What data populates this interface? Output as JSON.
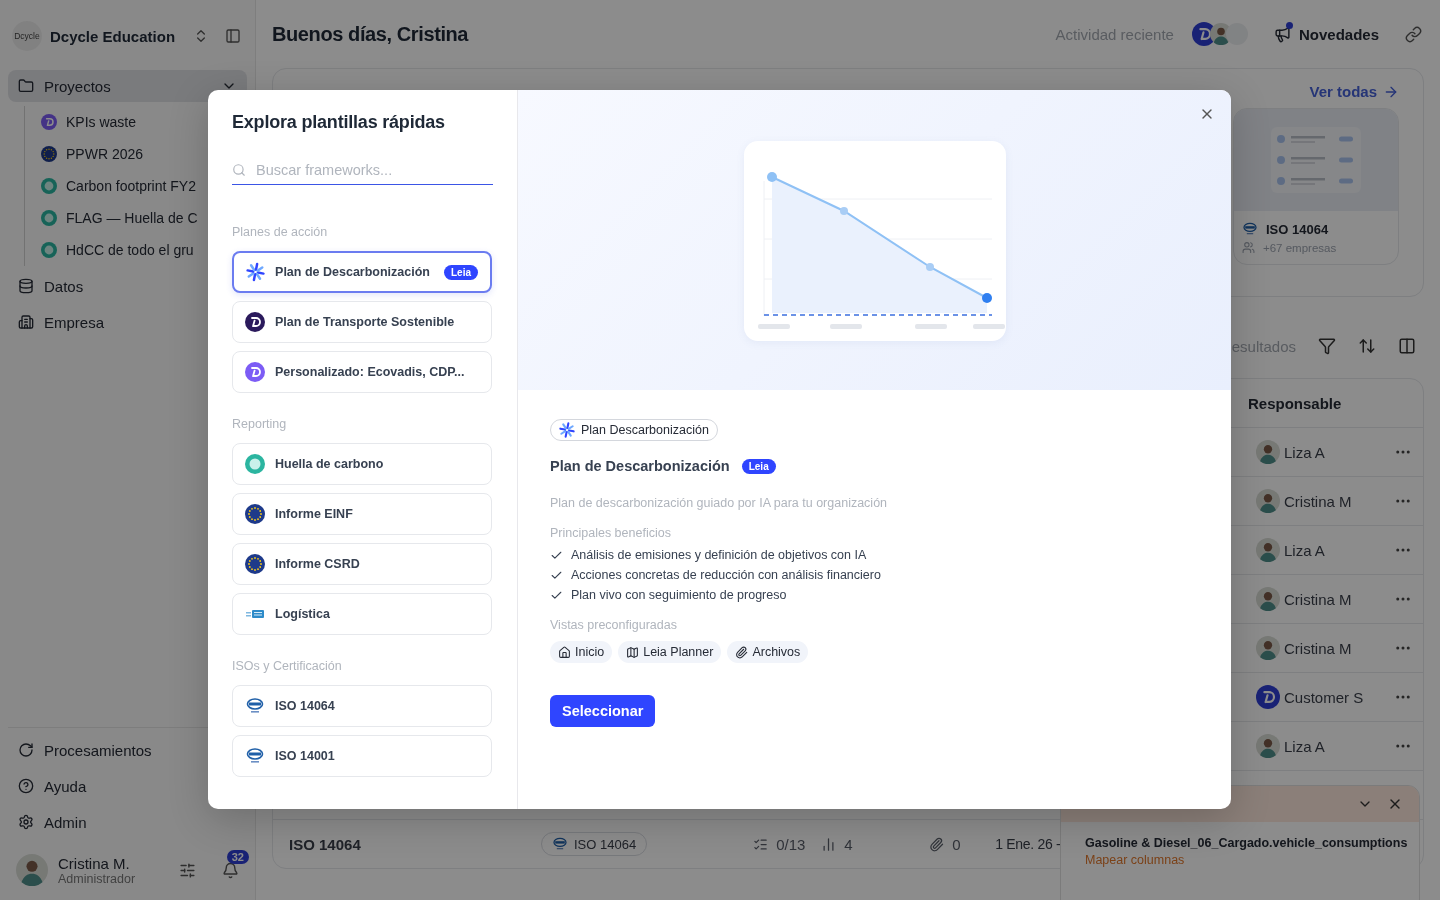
{
  "sidebar": {
    "logo_text": "Dcycle",
    "workspace": "Dcycle Education",
    "nav": [
      {
        "label": "Proyectos",
        "selected": true,
        "expanded": true,
        "children": [
          {
            "label": "KPIs waste",
            "kind": "dcycle"
          },
          {
            "label": "PPWR 2026",
            "kind": "flag"
          },
          {
            "label": "Carbon footprint FY2",
            "kind": "ring"
          },
          {
            "label": "FLAG — Huella de C",
            "kind": "ring"
          },
          {
            "label": "HdCC de todo el gru",
            "kind": "ring"
          }
        ]
      },
      {
        "label": "Datos",
        "selected": false
      },
      {
        "label": "Empresa",
        "selected": false
      }
    ],
    "bottom_nav": [
      {
        "label": "Procesamientos"
      },
      {
        "label": "Ayuda"
      },
      {
        "label": "Admin"
      }
    ],
    "user": {
      "name": "Cristina M.",
      "role": "Administrador",
      "notifications": "32"
    }
  },
  "header": {
    "greeting": "Buenos días, Cristina",
    "recent_activity": "Actividad reciente",
    "news": {
      "label": "Novedades",
      "unread": true
    }
  },
  "templates_panel": {
    "link": "Ver todas",
    "card": {
      "title": "ISO 14064",
      "companies": "+67 empresas"
    }
  },
  "table": {
    "results_text": "esultados",
    "owner_header": "Responsable",
    "rows": [
      {
        "owner": "Liza A",
        "kind": "person"
      },
      {
        "owner": "Cristina M",
        "kind": "person"
      },
      {
        "owner": "Liza A",
        "kind": "person"
      },
      {
        "owner": "Cristina M",
        "kind": "person"
      },
      {
        "owner": "Cristina M",
        "kind": "person"
      },
      {
        "owner": "Customer S",
        "kind": "company"
      },
      {
        "owner": "Liza A",
        "kind": "person"
      }
    ],
    "footer_row": {
      "name": "ISO 14064",
      "badge": "ISO 14064",
      "tasks": "0/13",
      "metrics": "4",
      "attachments": "0",
      "date": "1 Ene. 26 -"
    }
  },
  "upload_notification": {
    "file": "Gasoline & Diesel_06_Cargado.vehicle_consumptions",
    "action": "Mapear columnas"
  },
  "modal": {
    "title": "Explora plantillas rápidas",
    "search": {
      "placeholder": "Buscar frameworks..."
    },
    "sections": [
      {
        "label": "Planes de acción",
        "items": [
          {
            "label": "Plan de Descarbonización",
            "kind": "sparkle",
            "badge": "Leia",
            "selected": true
          },
          {
            "label": "Plan de Transporte Sostenible",
            "kind": "dcycle-dark",
            "selected": false
          },
          {
            "label": "Personalizado: Ecovadis, CDP...",
            "kind": "dcycle",
            "selected": false
          }
        ]
      },
      {
        "label": "Reporting",
        "items": [
          {
            "label": "Huella de carbono",
            "kind": "ring",
            "selected": false
          },
          {
            "label": "Informe EINF",
            "kind": "flag",
            "selected": false
          },
          {
            "label": "Informe CSRD",
            "kind": "flag",
            "selected": false
          },
          {
            "label": "Logística",
            "kind": "logistics",
            "selected": false
          }
        ]
      },
      {
        "label": "ISOs y Certificación",
        "items": [
          {
            "label": "ISO 14064",
            "kind": "iso",
            "selected": false
          },
          {
            "label": "ISO 14001",
            "kind": "iso",
            "selected": false
          }
        ]
      }
    ],
    "detail": {
      "tag": "Plan Descarbonización",
      "title": "Plan de Descarbonización",
      "badge": "Leia",
      "description": "Plan de descarbonización guiado por IA para tu organización",
      "benefits_label": "Principales beneficios",
      "benefits": [
        "Análisis de emisiones y definición de objetivos con IA",
        "Acciones concretas de reducción con análisis financiero",
        "Plan vivo con seguimiento de progreso"
      ],
      "views_label": "Vistas preconfiguradas",
      "views": [
        {
          "label": "Inicio"
        },
        {
          "label": "Leia Planner"
        },
        {
          "label": "Archivos"
        }
      ],
      "action": "Seleccionar"
    }
  }
}
